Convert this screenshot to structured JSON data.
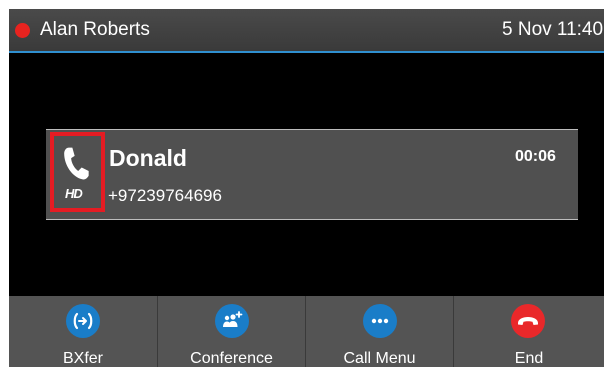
{
  "status_bar": {
    "user_name": "Alan Roberts",
    "datetime": "5 Nov 11:40"
  },
  "call": {
    "caller_name": "Donald",
    "caller_number": "+97239764696",
    "duration": "00:06",
    "hd_label": "HD"
  },
  "softkeys": [
    {
      "label": "BXfer",
      "icon": "blind-transfer-icon",
      "color": "#1a7dc8"
    },
    {
      "label": "Conference",
      "icon": "conference-icon",
      "color": "#1a7dc8"
    },
    {
      "label": "Call Menu",
      "icon": "more-icon",
      "color": "#1a7dc8"
    },
    {
      "label": "End",
      "icon": "end-call-icon",
      "color": "#e9282a"
    }
  ],
  "colors": {
    "accent_line": "#2f8fd0",
    "highlight_box": "#e51c23",
    "status_dot": "#e8231f"
  }
}
